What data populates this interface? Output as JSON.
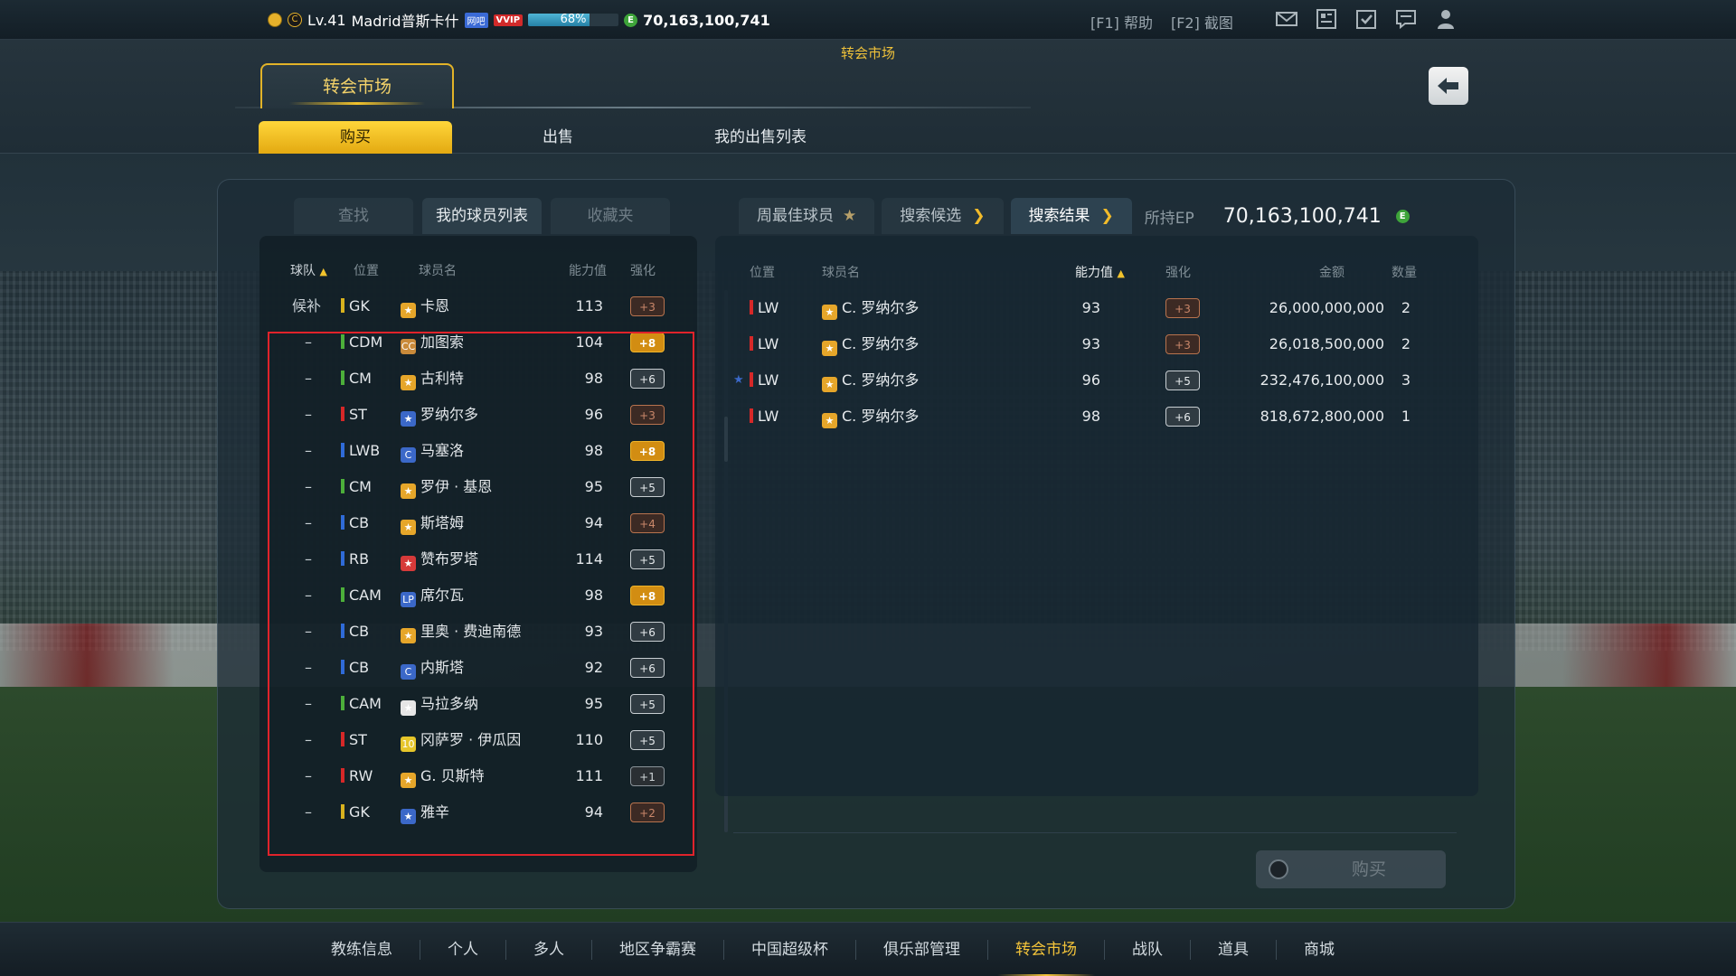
{
  "topbar": {
    "level": "Lv.41",
    "club_name": "Madrid普斯卡什",
    "badge_net": "网吧",
    "badge_vip": "VVIP",
    "xp_percent": "68%",
    "xp_fraction": 0.68,
    "currency": "70,163,100,741",
    "help": "[F1] 帮助",
    "screenshot": "[F2] 截图"
  },
  "header": {
    "page_title": "转会市场",
    "main_tab": "转会市场",
    "subtabs": [
      "购买",
      "出售",
      "我的出售列表"
    ]
  },
  "left": {
    "tabs": [
      "查找",
      "我的球员列表",
      "收藏夹"
    ],
    "columns": {
      "team": "球队",
      "pos": "位置",
      "name": "球员名",
      "ovr": "能力值",
      "enh": "强化"
    },
    "rows": [
      {
        "team": "候补",
        "pos": "GK",
        "color": "#d8b21e",
        "icon": "★",
        "iconbg": "#e6a62a",
        "name": "卡恩",
        "ovr": "113",
        "enh": "+3",
        "style": "bronze"
      },
      {
        "team": "–",
        "pos": "CDM",
        "color": "#4caf3a",
        "icon": "CC",
        "iconbg": "#c98a3a",
        "name": "加图索",
        "ovr": "104",
        "enh": "+8",
        "style": "gold"
      },
      {
        "team": "–",
        "pos": "CM",
        "color": "#4caf3a",
        "icon": "★",
        "iconbg": "#e6a62a",
        "name": "古利特",
        "ovr": "98",
        "enh": "+6",
        "style": "silver"
      },
      {
        "team": "–",
        "pos": "ST",
        "color": "#d62828",
        "icon": "★",
        "iconbg": "#3b68c8",
        "name": "罗纳尔多",
        "ovr": "96",
        "enh": "+3",
        "style": "bronze"
      },
      {
        "team": "–",
        "pos": "LWB",
        "color": "#2f6bd8",
        "icon": "C",
        "iconbg": "#3b68c8",
        "name": "马塞洛",
        "ovr": "98",
        "enh": "+8",
        "style": "gold"
      },
      {
        "team": "–",
        "pos": "CM",
        "color": "#4caf3a",
        "icon": "★",
        "iconbg": "#e6a62a",
        "name": "罗伊 · 基恩",
        "ovr": "95",
        "enh": "+5",
        "style": "silver"
      },
      {
        "team": "–",
        "pos": "CB",
        "color": "#2f6bd8",
        "icon": "★",
        "iconbg": "#e6a62a",
        "name": "斯塔姆",
        "ovr": "94",
        "enh": "+4",
        "style": "bronze"
      },
      {
        "team": "–",
        "pos": "RB",
        "color": "#2f6bd8",
        "icon": "★",
        "iconbg": "#d63a3a",
        "name": "赞布罗塔",
        "ovr": "114",
        "enh": "+5",
        "style": "silver"
      },
      {
        "team": "–",
        "pos": "CAM",
        "color": "#4caf3a",
        "icon": "LP",
        "iconbg": "#3b68c8",
        "name": "席尔瓦",
        "ovr": "98",
        "enh": "+8",
        "style": "gold"
      },
      {
        "team": "–",
        "pos": "CB",
        "color": "#2f6bd8",
        "icon": "★",
        "iconbg": "#e6a62a",
        "name": "里奥 · 费迪南德",
        "ovr": "93",
        "enh": "+6",
        "style": "silver"
      },
      {
        "team": "–",
        "pos": "CB",
        "color": "#2f6bd8",
        "icon": "C",
        "iconbg": "#3b68c8",
        "name": "内斯塔",
        "ovr": "92",
        "enh": "+6",
        "style": "silver"
      },
      {
        "team": "–",
        "pos": "CAM",
        "color": "#4caf3a",
        "icon": "★",
        "iconbg": "#e6e6e6",
        "name": "马拉多纳",
        "ovr": "95",
        "enh": "+5",
        "style": "silver"
      },
      {
        "team": "–",
        "pos": "ST",
        "color": "#d62828",
        "icon": "10",
        "iconbg": "#e6c62a",
        "name": "冈萨罗 · 伊瓜因",
        "ovr": "110",
        "enh": "+5",
        "style": "silver"
      },
      {
        "team": "–",
        "pos": "RW",
        "color": "#d62828",
        "icon": "★",
        "iconbg": "#e6a62a",
        "name": "G. 贝斯特",
        "ovr": "111",
        "enh": "+1",
        "style": "dark"
      },
      {
        "team": "–",
        "pos": "GK",
        "color": "#d8b21e",
        "icon": "★",
        "iconbg": "#3b68c8",
        "name": "雅辛",
        "ovr": "94",
        "enh": "+2",
        "style": "bronze"
      }
    ]
  },
  "right": {
    "tabs": [
      "周最佳球员",
      "搜索候选",
      "搜索结果"
    ],
    "ep_label": "所持EP",
    "ep_value": "70,163,100,741",
    "columns": {
      "pos": "位置",
      "name": "球员名",
      "ovr": "能力值",
      "enh": "强化",
      "price": "金额",
      "qty": "数量"
    },
    "rows": [
      {
        "pos": "LW",
        "name": "C. 罗纳尔多",
        "ovr": "93",
        "enh": "+3",
        "style": "bronze",
        "price": "26,000,000,000",
        "qty": "2"
      },
      {
        "pos": "LW",
        "name": "C. 罗纳尔多",
        "ovr": "93",
        "enh": "+3",
        "style": "bronze",
        "price": "26,018,500,000",
        "qty": "2"
      },
      {
        "pos": "LW",
        "name": "C. 罗纳尔多",
        "ovr": "96",
        "enh": "+5",
        "style": "silver",
        "price": "232,476,100,000",
        "qty": "3"
      },
      {
        "pos": "LW",
        "name": "C. 罗纳尔多",
        "ovr": "98",
        "enh": "+6",
        "style": "silver",
        "price": "818,672,800,000",
        "qty": "1"
      }
    ],
    "buy_label": "购买"
  },
  "footer": {
    "nav": [
      "教练信息",
      "个人",
      "多人",
      "地区争霸赛",
      "中国超级杯",
      "俱乐部管理",
      "转会市场",
      "战队",
      "道具",
      "商城"
    ],
    "active_index": 6
  },
  "colors": {
    "accent": "#f2c32c",
    "highlight_box": "#e0232b"
  }
}
